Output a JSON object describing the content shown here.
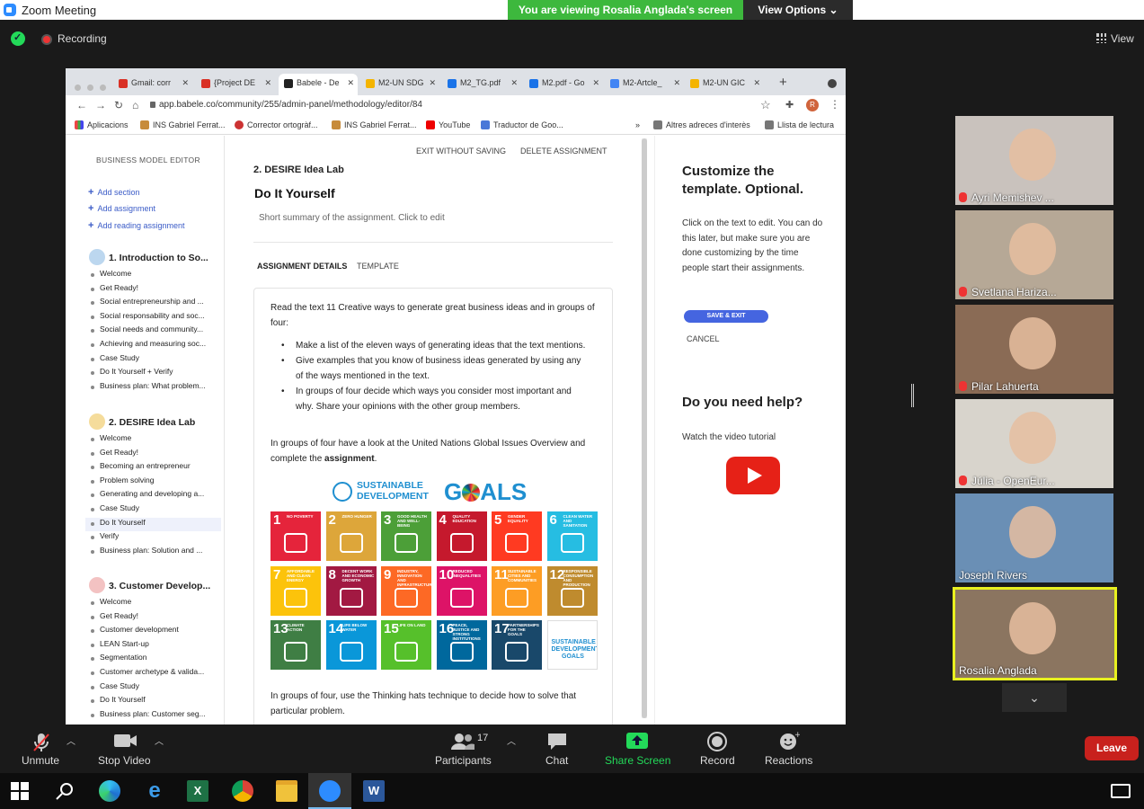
{
  "window": {
    "title": "Zoom Meeting"
  },
  "share_banner": {
    "viewing": "You are viewing Rosalia Anglada's screen",
    "view_options": "View Options"
  },
  "top": {
    "recording": "Recording",
    "view": "View"
  },
  "browser": {
    "tabs": [
      {
        "label": "Gmail: corr",
        "color": "#d93025"
      },
      {
        "label": "{Project DE",
        "color": "#d93025"
      },
      {
        "label": "Babele - De",
        "color": "#222222"
      },
      {
        "label": "M2-UN SDG",
        "color": "#f4b400"
      },
      {
        "label": "M2_TG.pdf",
        "color": "#1a73e8"
      },
      {
        "label": "M2.pdf - Go",
        "color": "#1a73e8"
      },
      {
        "label": "M2-Artcle_",
        "color": "#4285f4"
      },
      {
        "label": "M2-UN GIC",
        "color": "#f4b400"
      }
    ],
    "url": "app.babele.co/community/255/admin-panel/methodology/editor/84",
    "avatar_letter": "R",
    "bookmarks": [
      "Aplicacions",
      "INS Gabriel Ferrat...",
      "Corrector ortogràf...",
      "INS Gabriel Ferrat...",
      "YouTube",
      "Traductor de Goo..."
    ],
    "bookmarks_more": "»",
    "bookmarks_right": [
      "Altres adreces d'interès",
      "Llista de lectura"
    ]
  },
  "sidebar": {
    "header": "BUSINESS MODEL EDITOR",
    "add_section": "Add section",
    "add_assignment": "Add assignment",
    "add_reading": "Add reading assignment",
    "sections": [
      {
        "title": "1. Introduction to So...",
        "items": [
          "Welcome",
          "Get Ready!",
          "Social entrepreneurship and ...",
          "Social responsability and soc...",
          "Social needs and community...",
          "Achieving and measuring soc...",
          "Case Study",
          "Do It Yourself + Verify",
          "Business plan: What problem..."
        ]
      },
      {
        "title": "2. DESIRE Idea Lab",
        "items": [
          "Welcome",
          "Get Ready!",
          "Becoming an entrepreneur",
          "Problem solving",
          "Generating and developing a...",
          "Case Study",
          "Do It Yourself",
          "Verify",
          "Business plan: Solution and ..."
        ]
      },
      {
        "title": "3. Customer Develop...",
        "items": [
          "Welcome",
          "Get Ready!",
          "Customer development",
          "LEAN Start-up",
          "Segmentation",
          "Customer archetype & valida...",
          "Case Study",
          "Do It Yourself",
          "Business plan: Customer seg..."
        ]
      }
    ]
  },
  "editor": {
    "exit_without_saving": "EXIT WITHOUT SAVING",
    "delete_assignment": "DELETE ASSIGNMENT",
    "section_title": "2. DESIRE Idea Lab",
    "assignment_title": "Do It Yourself",
    "summary_placeholder": "Short summary of the assignment. Click to edit",
    "tab_details": "ASSIGNMENT DETAILS",
    "tab_template": "TEMPLATE",
    "intro": "Read the text 11 Creative ways to generate great business ideas and in groups of four:",
    "bullets": [
      "Make a list of the eleven ways of generating ideas that the text mentions.",
      "Give examples that you know of business ideas generated by using any of the ways mentioned in the text.",
      "In groups of four decide which ways you consider most important and why. Share your opinions with the other group members."
    ],
    "para2_a": "In groups of four have a look at the United Nations Global Issues Overview and complete the",
    "para2_bold": "assignment",
    "para2_end": ".",
    "para3": "In groups of four, use the Thinking hats technique to decide how to solve that particular problem.",
    "sdg_logo_line1": "SUSTAINABLE",
    "sdg_logo_line2": "DEVELOPMENT",
    "sdg_logo_goals_a": "G",
    "sdg_logo_goals_b": "ALS",
    "sdg_tiles": [
      {
        "n": "1",
        "t": "NO POVERTY",
        "color": "#e5243b"
      },
      {
        "n": "2",
        "t": "ZERO HUNGER",
        "color": "#dda63a"
      },
      {
        "n": "3",
        "t": "GOOD HEALTH AND WELL-BEING",
        "color": "#4c9f38"
      },
      {
        "n": "4",
        "t": "QUALITY EDUCATION",
        "color": "#c5192d"
      },
      {
        "n": "5",
        "t": "GENDER EQUALITY",
        "color": "#ff3a21"
      },
      {
        "n": "6",
        "t": "CLEAN WATER AND SANITATION",
        "color": "#26bde2"
      },
      {
        "n": "7",
        "t": "AFFORDABLE AND CLEAN ENERGY",
        "color": "#fcc30b"
      },
      {
        "n": "8",
        "t": "DECENT WORK AND ECONOMIC GROWTH",
        "color": "#a21942"
      },
      {
        "n": "9",
        "t": "INDUSTRY, INNOVATION AND INFRASTRUCTURE",
        "color": "#fd6925"
      },
      {
        "n": "10",
        "t": "REDUCED INEQUALITIES",
        "color": "#dd1367"
      },
      {
        "n": "11",
        "t": "SUSTAINABLE CITIES AND COMMUNITIES",
        "color": "#fd9d24"
      },
      {
        "n": "12",
        "t": "RESPONSIBLE CONSUMPTION AND PRODUCTION",
        "color": "#bf8b2e"
      },
      {
        "n": "13",
        "t": "CLIMATE ACTION",
        "color": "#3f7e44"
      },
      {
        "n": "14",
        "t": "LIFE BELOW WATER",
        "color": "#0a97d9"
      },
      {
        "n": "15",
        "t": "LIFE ON LAND",
        "color": "#56c02b"
      },
      {
        "n": "16",
        "t": "PEACE, JUSTICE AND STRONG INSTITUTIONS",
        "color": "#00689d"
      },
      {
        "n": "17",
        "t": "PARTNERSHIPS FOR THE GOALS",
        "color": "#19486a"
      },
      {
        "n": "",
        "t": "SUSTAINABLE DEVELOPMENT GOALS",
        "color": "#ffffff"
      }
    ]
  },
  "right_panel": {
    "title": "Customize the template. Optional.",
    "text": "Click on the text to edit. You can do this later, but make sure you are done customizing by the time people start their assignments.",
    "save_exit": "SAVE & EXIT",
    "cancel": "CANCEL",
    "help_title": "Do you need help?",
    "watch": "Watch the video tutorial"
  },
  "participants": [
    {
      "name": "Ayri Memishev ...",
      "muted": true,
      "bg": "#c9c2bd"
    },
    {
      "name": "Svetlana Hariza...",
      "muted": true,
      "bg": "#b6a896"
    },
    {
      "name": "Pilar Lahuerta",
      "muted": true,
      "bg": "#8a6b55"
    },
    {
      "name": "Júlia - OpenEur...",
      "muted": true,
      "bg": "#d8d4cc"
    },
    {
      "name": "Joseph Rivers",
      "muted": false,
      "bg": "#6a8fb5"
    },
    {
      "name": "Rosalia Anglada",
      "muted": false,
      "bg": "#8b7560"
    }
  ],
  "toolbar": {
    "unmute": "Unmute",
    "stop_video": "Stop Video",
    "participants": "Participants",
    "participants_count": "17",
    "chat": "Chat",
    "share_screen": "Share Screen",
    "record": "Record",
    "reactions": "Reactions",
    "leave": "Leave"
  },
  "taskbar_apps": [
    "windows-start",
    "search",
    "edge",
    "internet-explorer",
    "excel",
    "chrome",
    "file-explorer",
    "zoom",
    "word"
  ]
}
